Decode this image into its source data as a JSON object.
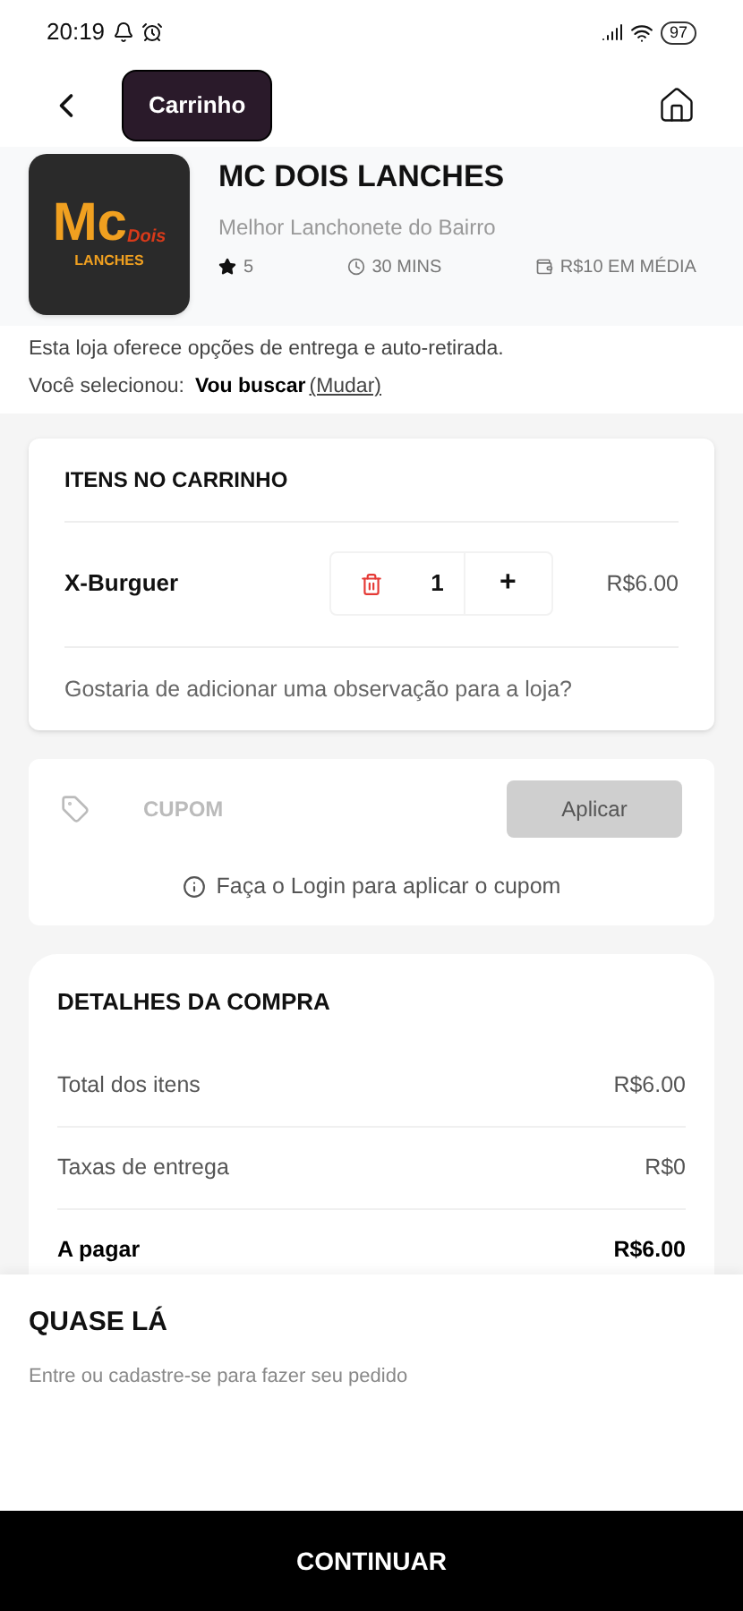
{
  "status_bar": {
    "time": "20:19",
    "battery": "97"
  },
  "header": {
    "title": "Carrinho"
  },
  "store": {
    "logo": {
      "main": "Mc",
      "accent": "Dois",
      "tagline": "LANCHES"
    },
    "name": "MC DOIS LANCHES",
    "tagline": "Melhor Lanchonete do Bairro",
    "rating": "5",
    "time": "30 MINS",
    "average": "R$10 EM MÉDIA"
  },
  "delivery": {
    "info": "Esta loja oferece opções de entrega e auto-retirada.",
    "selected_label": "Você selecionou:",
    "selected_value": "Vou buscar",
    "change": "(Mudar)"
  },
  "cart": {
    "title": "ITENS NO CARRINHO",
    "items": [
      {
        "name": "X-Burguer",
        "quantity": "1",
        "plus": "+",
        "price": "R$6.00"
      }
    ],
    "note": "Gostaria de adicionar uma observação para a loja?"
  },
  "coupon": {
    "placeholder": "CUPOM",
    "button": "Aplicar",
    "disabled": true,
    "login_hint": "Faça o Login para aplicar o cupom"
  },
  "details": {
    "title": "DETALHES DA COMPRA",
    "rows": [
      {
        "label": "Total dos itens",
        "value": "R$6.00",
        "bold": false
      },
      {
        "label": "Taxas de entrega",
        "value": "R$0",
        "bold": false
      },
      {
        "label": "A pagar",
        "value": "R$6.00",
        "bold": true
      }
    ]
  },
  "sheet": {
    "title": "QUASE LÁ",
    "subtitle": "Entre ou cadastre-se para fazer seu pedido",
    "button": "CONTINUAR"
  }
}
